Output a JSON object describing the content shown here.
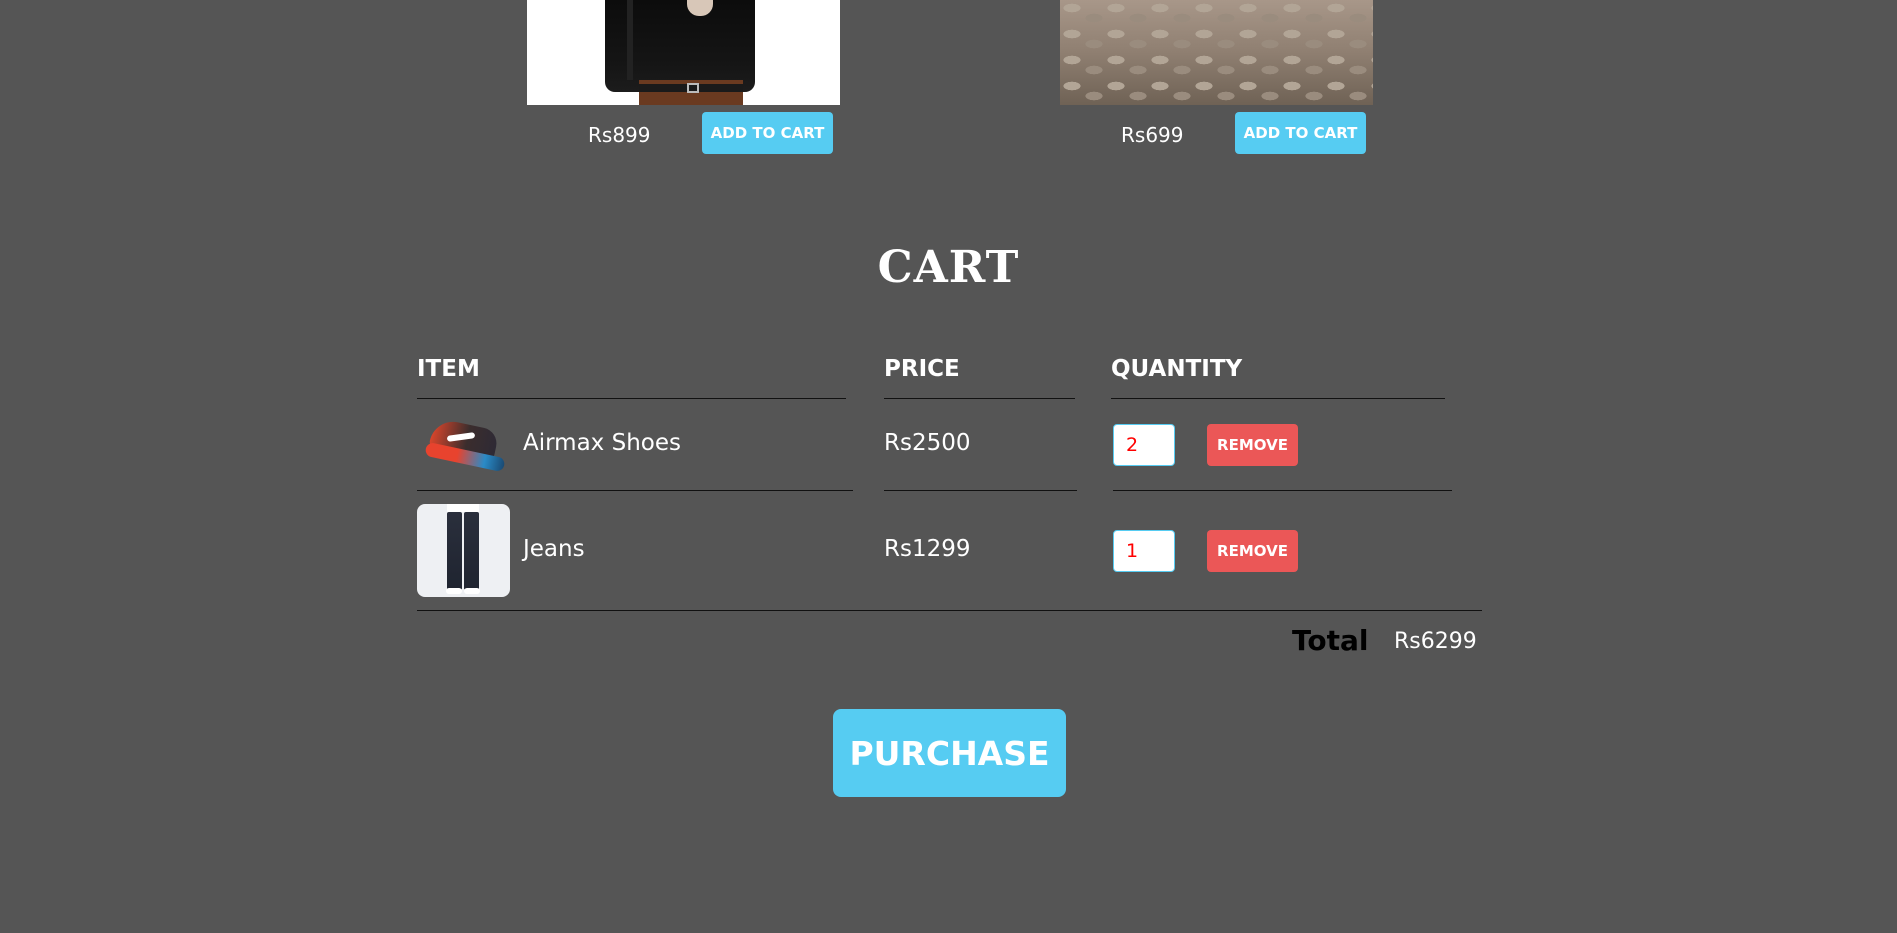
{
  "products": [
    {
      "price": "Rs899",
      "add_label": "ADD TO CART",
      "image": "black-shirt-photo"
    },
    {
      "price": "Rs699",
      "add_label": "ADD TO CART",
      "image": "cobblestone-photo"
    }
  ],
  "cart": {
    "title": "CART",
    "headers": {
      "item": "ITEM",
      "price": "PRICE",
      "quantity": "QUANTITY"
    },
    "rows": [
      {
        "name": "Airmax Shoes",
        "price": "Rs2500",
        "quantity": "2",
        "remove_label": "REMOVE",
        "image": "sneaker-photo"
      },
      {
        "name": "Jeans",
        "price": "Rs1299",
        "quantity": "1",
        "remove_label": "REMOVE",
        "image": "jeans-photo"
      }
    ],
    "total_label": "Total",
    "total_value": "Rs6299"
  },
  "purchase_label": "PURCHASE",
  "colors": {
    "background": "#555555",
    "accent": "#56ccf2",
    "danger": "#eb5757",
    "quantity_text": "#ff0000"
  }
}
